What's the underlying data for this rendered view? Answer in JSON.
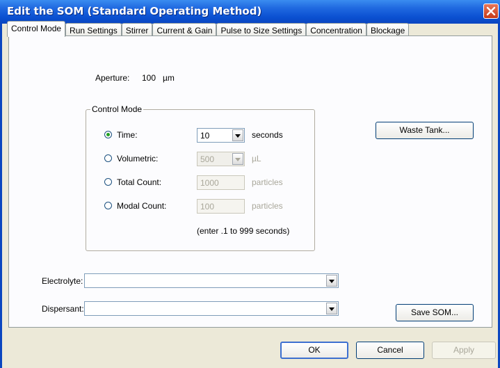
{
  "window": {
    "title": "Edit the SOM (Standard Operating Method)"
  },
  "tabs": [
    {
      "label": "Control Mode",
      "active": true
    },
    {
      "label": "Run Settings"
    },
    {
      "label": "Stirrer"
    },
    {
      "label": "Current & Gain"
    },
    {
      "label": "Pulse to Size Settings"
    },
    {
      "label": "Concentration"
    },
    {
      "label": "Blockage"
    }
  ],
  "aperture": {
    "label": "Aperture:",
    "value": "100",
    "unit": "µm"
  },
  "control_mode": {
    "legend": "Control Mode",
    "time": {
      "label": "Time:",
      "value": "10",
      "unit": "seconds"
    },
    "volumetric": {
      "label": "Volumetric:",
      "value": "500",
      "unit": "µL"
    },
    "total_count": {
      "label": "Total Count:",
      "value": "1000",
      "unit": "particles"
    },
    "modal_count": {
      "label": "Modal Count:",
      "value": "100",
      "unit": "particles"
    },
    "hint": "(enter .1 to 999 seconds)"
  },
  "waste_tank_label": "Waste Tank...",
  "electrolyte": {
    "label": "Electrolyte:",
    "value": ""
  },
  "dispersant": {
    "label": "Dispersant:",
    "value": ""
  },
  "save_som_label": "Save SOM...",
  "footer": {
    "ok": "OK",
    "cancel": "Cancel",
    "apply": "Apply"
  }
}
